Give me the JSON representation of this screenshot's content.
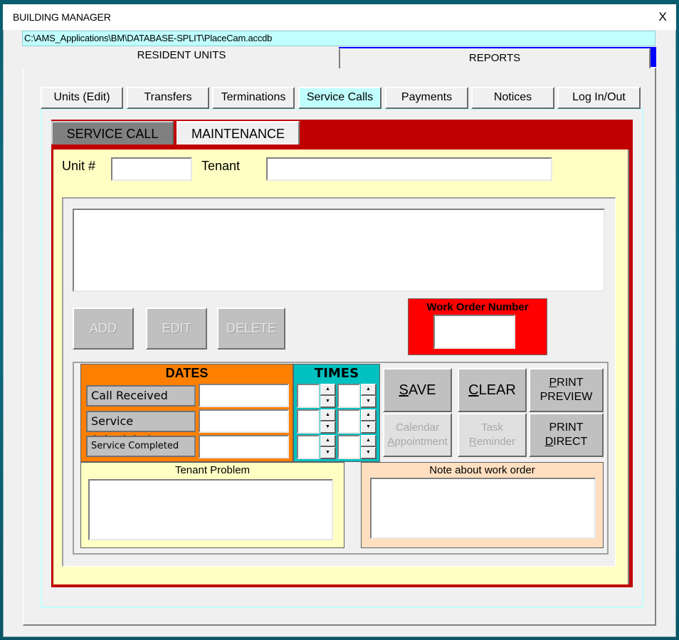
{
  "window": {
    "title": "BUILDING MANAGER",
    "close_label": "X",
    "db_path": "C:\\AMS_Applications\\BM\\DATABASE-SPLIT\\PlaceCam.accdb"
  },
  "top_tabs": [
    {
      "label": "RESIDENT UNITS",
      "active": true
    },
    {
      "label": "REPORTS",
      "active": false
    }
  ],
  "nav": {
    "buttons": [
      {
        "label": "Units (Edit)",
        "active": false
      },
      {
        "label": "Transfers",
        "active": false
      },
      {
        "label": "Terminations",
        "active": false
      },
      {
        "label": "Service Calls",
        "active": true
      },
      {
        "label": "Payments",
        "active": false
      },
      {
        "label": "Notices",
        "active": false
      },
      {
        "label": "Log In/Out",
        "active": false
      }
    ]
  },
  "sub_tabs": [
    {
      "label": "SERVICE CALL",
      "active": true
    },
    {
      "label": "MAINTENANCE",
      "active": false
    }
  ],
  "form": {
    "unit_label": "Unit #",
    "unit_value": "",
    "tenant_label": "Tenant",
    "tenant_value": "",
    "list_items": [],
    "buttons": {
      "add": "ADD",
      "edit": "EDIT",
      "delete": "DELETE"
    },
    "work_order": {
      "label": "Work Order Number",
      "value": ""
    },
    "dates": {
      "title": "DATES",
      "rows": [
        {
          "label": "Call Received",
          "value": ""
        },
        {
          "label": "Service Scheduled",
          "value": ""
        },
        {
          "label": "Service Completed",
          "value": ""
        }
      ]
    },
    "times": {
      "title": "TIMES",
      "rows": [
        {
          "hour": "",
          "minute": ""
        },
        {
          "hour": "",
          "minute": ""
        },
        {
          "hour": "",
          "minute": ""
        }
      ],
      "spin_up": "▲",
      "spin_down": "▼"
    },
    "actions": {
      "save": {
        "accel": "S",
        "rest": "AVE"
      },
      "clear": {
        "accel": "C",
        "rest": "LEAR"
      },
      "print_preview": {
        "accel": "P",
        "line1_rest": "RINT",
        "line2": "PREVIEW"
      },
      "calendar": {
        "line1": "Calendar",
        "accel": "A",
        "line2_rest": "ppointment"
      },
      "task": {
        "line1": "Task",
        "accel": "R",
        "line2_rest": "eminder"
      },
      "print_direct": {
        "line1": "PRINT",
        "accel": "D",
        "line2_rest": "IRECT"
      }
    },
    "tenant_problem": {
      "label": "Tenant Problem",
      "value": ""
    },
    "note": {
      "label": "Note about work order",
      "value": ""
    }
  },
  "colors": {
    "path_bg": "#c0ffff",
    "reports_accent": "#0000ff",
    "red_band": "#c00000",
    "yellow_panel": "#ffffc4",
    "dates_bg": "#ff8000",
    "times_bg": "#00c0c0",
    "work_order_bg": "#ff0000",
    "note_bg": "#ffdfc0"
  }
}
